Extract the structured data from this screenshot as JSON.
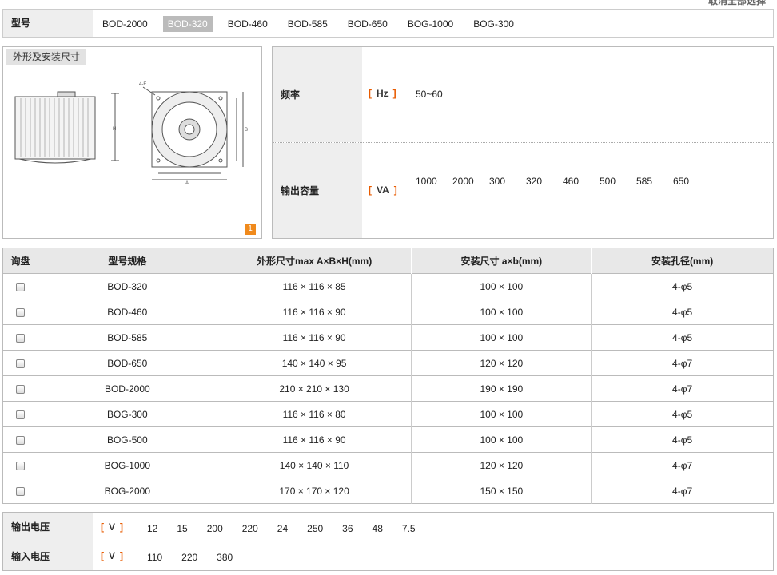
{
  "top_cut_text": "取消全部选择",
  "model": {
    "label": "型号",
    "options": [
      "BOD-2000",
      "BOD-320",
      "BOD-460",
      "BOD-585",
      "BOD-650",
      "BOG-1000",
      "BOG-300"
    ],
    "selected": "BOD-320"
  },
  "drawing": {
    "tag": "外形及安装尺寸",
    "page": "1"
  },
  "frequency": {
    "label": "频率",
    "unit": "Hz",
    "values": [
      "50~60"
    ]
  },
  "capacity": {
    "label": "输出容量",
    "unit": "VA",
    "values": [
      "1000",
      "2000",
      "300",
      "320",
      "460",
      "500",
      "585",
      "650"
    ]
  },
  "table": {
    "headers": [
      "询盘",
      "型号规格",
      "外形尺寸max A×B×H(mm)",
      "安装尺寸 a×b(mm)",
      "安装孔径(mm)"
    ],
    "rows": [
      [
        "BOD-320",
        "116 × 116 × 85",
        "100 × 100",
        "4-φ5"
      ],
      [
        "BOD-460",
        "116 × 116 × 90",
        "100 × 100",
        "4-φ5"
      ],
      [
        "BOD-585",
        "116 × 116 × 90",
        "100 × 100",
        "4-φ5"
      ],
      [
        "BOD-650",
        "140 × 140 × 95",
        "120 × 120",
        "4-φ7"
      ],
      [
        "BOD-2000",
        "210 × 210 × 130",
        "190 × 190",
        "4-φ7"
      ],
      [
        "BOG-300",
        "116 × 116 × 80",
        "100 × 100",
        "4-φ5"
      ],
      [
        "BOG-500",
        "116 × 116 × 90",
        "100 × 100",
        "4-φ5"
      ],
      [
        "BOG-1000",
        "140 × 140 × 110",
        "120 × 120",
        "4-φ7"
      ],
      [
        "BOG-2000",
        "170 × 170 × 120",
        "150 × 150",
        "4-φ7"
      ]
    ]
  },
  "output_voltage": {
    "label": "输出电压",
    "unit": "V",
    "values": [
      "12",
      "15",
      "200",
      "220",
      "24",
      "250",
      "36",
      "48",
      "7.5"
    ]
  },
  "input_voltage": {
    "label": "输入电压",
    "unit": "V",
    "values": [
      "110",
      "220",
      "380"
    ]
  },
  "colors": {
    "accent": "#e85b00",
    "label_bg": "#eeeeee",
    "selected_bg": "#bbbbbb",
    "page_badge": "#f08a1c"
  }
}
